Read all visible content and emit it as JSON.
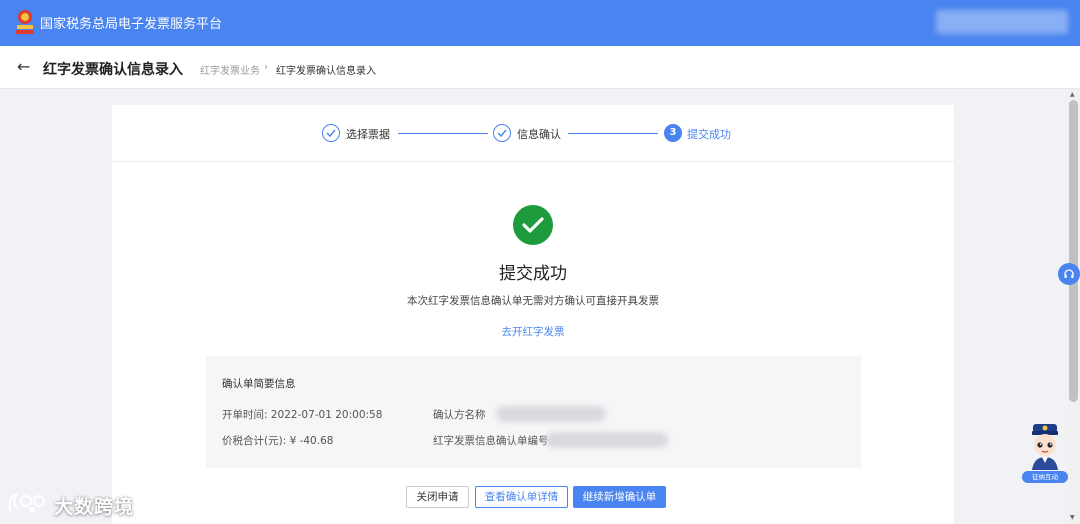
{
  "header": {
    "platform_title": "国家税务总局电子发票服务平台"
  },
  "page": {
    "title": "红字发票确认信息录入",
    "breadcrumb": [
      "红字发票业务",
      "红字发票确认信息录入"
    ],
    "breadcrumb_sep": "›",
    "back_icon": "←"
  },
  "steps": [
    {
      "label": "选择票据",
      "state": "done"
    },
    {
      "label": "信息确认",
      "state": "done"
    },
    {
      "label": "提交成功",
      "state": "active",
      "number": "3"
    }
  ],
  "result": {
    "title": "提交成功",
    "description": "本次红字发票信息确认单无需对方确认可直接开具发票",
    "link": "去开红字发票"
  },
  "summary": {
    "title": "确认单简要信息",
    "open_time": "开单时间: 2022-07-01 20:00:58",
    "total": "价税合计(元): ¥ -40.68",
    "confirm_party_label": "确认方名称",
    "confirm_no_label": "红字发票信息确认单编号:"
  },
  "actions": {
    "close": "关闭申请",
    "view": "查看确认单详情",
    "continue": "继续新增确认单"
  },
  "assistant": {
    "badge": "征纳互动"
  },
  "watermark": {
    "text": "大数跨境"
  },
  "colors": {
    "primary": "#4a84f0",
    "success": "#1e9b3c",
    "panel": "#f5f6f8"
  }
}
